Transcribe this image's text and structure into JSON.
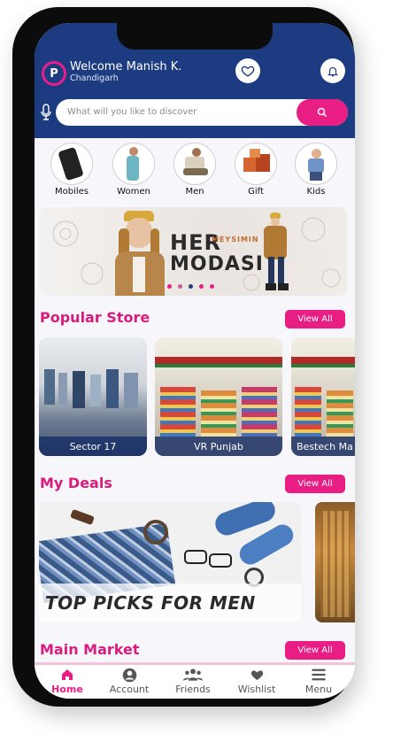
{
  "header": {
    "welcome": "Welcome Manish K.",
    "city": "Chandigarh",
    "logo_letter": "P"
  },
  "search": {
    "placeholder": "What will you like to discover"
  },
  "categories": [
    {
      "label": "Mobiles"
    },
    {
      "label": "Women"
    },
    {
      "label": "Men"
    },
    {
      "label": "Gift"
    },
    {
      "label": "Kids"
    }
  ],
  "banner": {
    "line1": "HER",
    "line1_small": "MEYSIMIN",
    "line2": "MODASI",
    "slides": 5
  },
  "popular_store": {
    "title": "Popular Store",
    "view_all": "View All",
    "stores": [
      {
        "name": "Sector 17"
      },
      {
        "name": "VR Punjab"
      },
      {
        "name": "Bestech Ma"
      }
    ]
  },
  "my_deals": {
    "title": "My Deals",
    "view_all": "View All",
    "deal_text": "TOP PICKS FOR MEN"
  },
  "main_market": {
    "title": "Main Market",
    "view_all": "View All"
  },
  "nav": [
    {
      "label": "Home",
      "icon": "home-icon"
    },
    {
      "label": "Account",
      "icon": "account-icon"
    },
    {
      "label": "Friends",
      "icon": "friends-icon"
    },
    {
      "label": "Wishlist",
      "icon": "heart-icon"
    },
    {
      "label": "Menu",
      "icon": "menu-icon"
    }
  ],
  "colors": {
    "primary": "#1d3b80",
    "accent": "#e81e84",
    "title": "#d81b7e"
  }
}
